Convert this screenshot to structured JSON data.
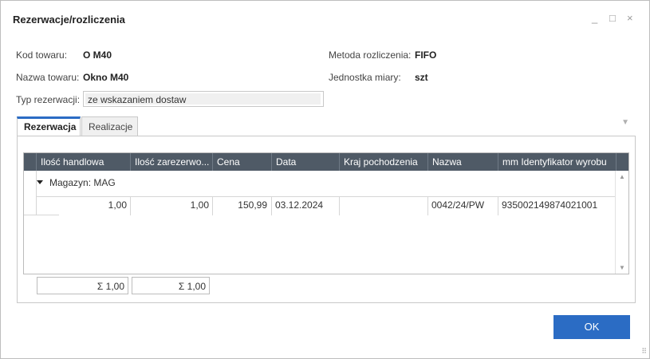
{
  "window": {
    "title": "Rezerwacje/rozliczenia",
    "controls": {
      "minimize": "_",
      "maximize": "□",
      "close": "×"
    }
  },
  "fields": {
    "kod_towaru_label": "Kod towaru:",
    "kod_towaru_value": "O M40",
    "nazwa_towaru_label": "Nazwa towaru:",
    "nazwa_towaru_value": "Okno M40",
    "metoda_label": "Metoda rozliczenia:",
    "metoda_value": "FIFO",
    "jednostka_label": "Jednostka miary:",
    "jednostka_value": "szt",
    "typ_rezerwacji_label": "Typ rezerwacji:",
    "typ_rezerwacji_value": "ze wskazaniem dostaw"
  },
  "tabs": [
    {
      "label": "Rezerwacja",
      "active": true
    },
    {
      "label": "Realizacje",
      "active": false
    }
  ],
  "grid": {
    "columns": [
      "Ilość handlowa",
      "Ilość zarezerwo...",
      "Cena",
      "Data",
      "Kraj pochodzenia",
      "Nazwa",
      "mm Identyfikator wyrobu"
    ],
    "group_label": "Magazyn: MAG",
    "rows": [
      {
        "ilosc_handlowa": "1,00",
        "ilosc_zarezerwowana": "1,00",
        "cena": "150,99",
        "data": "03.12.2024",
        "kraj_pochodzenia": "",
        "nazwa": "0042/24/PW",
        "identyfikator": "935002149874021001"
      }
    ],
    "totals": {
      "ilosc_handlowa": "Σ  1,00",
      "ilosc_zarezerwowana": "Σ  1,00"
    }
  },
  "buttons": {
    "ok": "OK"
  },
  "colors": {
    "accent": "#2b6cc4",
    "grid_header": "#4f5a66"
  }
}
